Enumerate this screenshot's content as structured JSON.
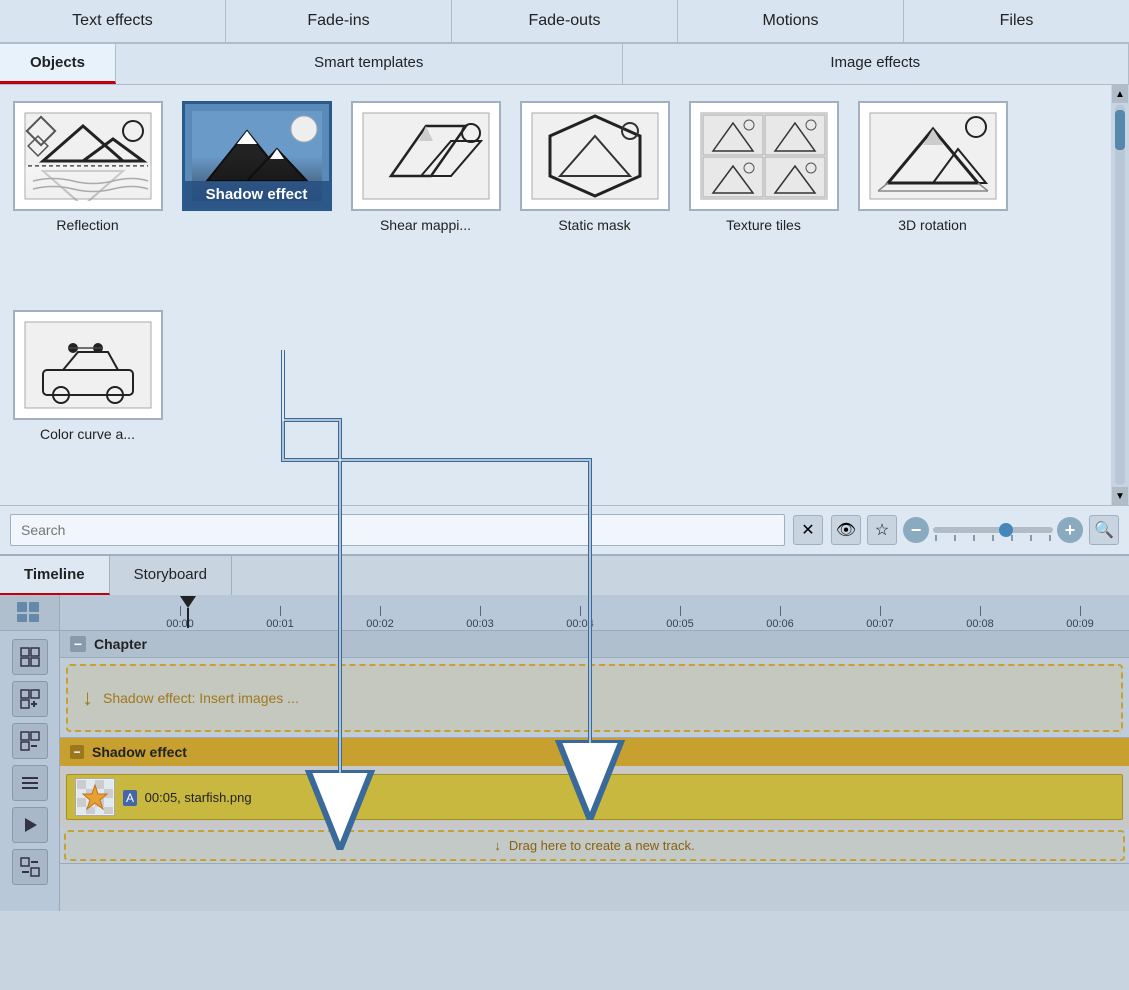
{
  "topTabs": [
    {
      "label": "Text effects",
      "active": false
    },
    {
      "label": "Fade-ins",
      "active": false
    },
    {
      "label": "Fade-outs",
      "active": false
    },
    {
      "label": "Motions",
      "active": false
    },
    {
      "label": "Files",
      "active": false
    }
  ],
  "secondTabs": [
    {
      "label": "Objects",
      "active": true
    },
    {
      "label": "Smart templates",
      "active": false
    },
    {
      "label": "Image effects",
      "active": false
    }
  ],
  "effects": [
    {
      "id": "reflection",
      "label": "Reflection",
      "selected": false
    },
    {
      "id": "shadow-effect",
      "label": "Shadow effect",
      "selected": true
    },
    {
      "id": "shear-mapping",
      "label": "Shear mappi...",
      "selected": false
    },
    {
      "id": "static-mask",
      "label": "Static mask",
      "selected": false
    },
    {
      "id": "texture-tiles",
      "label": "Texture tiles",
      "selected": false
    },
    {
      "id": "3d-rotation",
      "label": "3D rotation",
      "selected": false
    },
    {
      "id": "color-curve",
      "label": "Color curve a...",
      "selected": false
    }
  ],
  "search": {
    "placeholder": "Search",
    "value": ""
  },
  "timeline": {
    "tabs": [
      {
        "label": "Timeline",
        "active": true
      },
      {
        "label": "Storyboard",
        "active": false
      }
    ],
    "rulerMarks": [
      "00:00",
      "00:01",
      "00:02",
      "00:03",
      "00:04",
      "00:05",
      "00:06",
      "00:07",
      "00:08",
      "00:09"
    ],
    "chapterLabel": "Chapter",
    "insertText": "Shadow effect: Insert images ...",
    "shadowEffectLabel": "Shadow effect",
    "clipInfo": "00:05, starfish.png",
    "dragHereText": "Drag here to create a new track."
  },
  "icons": {
    "clear": "✕",
    "eye": "👁",
    "star": "☆",
    "minus": "−",
    "plus": "+",
    "search": "🔍",
    "arrowDown": "↓",
    "gridTool": "⊞",
    "tool2": "⊟",
    "tool3": "⊠",
    "tool4": "≡",
    "tool5": "▶",
    "tool6": "⊡"
  },
  "colors": {
    "accent": "#3a6a9a",
    "tabActive": "#e8f2fb",
    "selectedEffect": "#5a8ab8",
    "timelineBg": "#c8d4e0",
    "chapterBg": "#c8a030",
    "trackDashed": "#c8a030"
  }
}
